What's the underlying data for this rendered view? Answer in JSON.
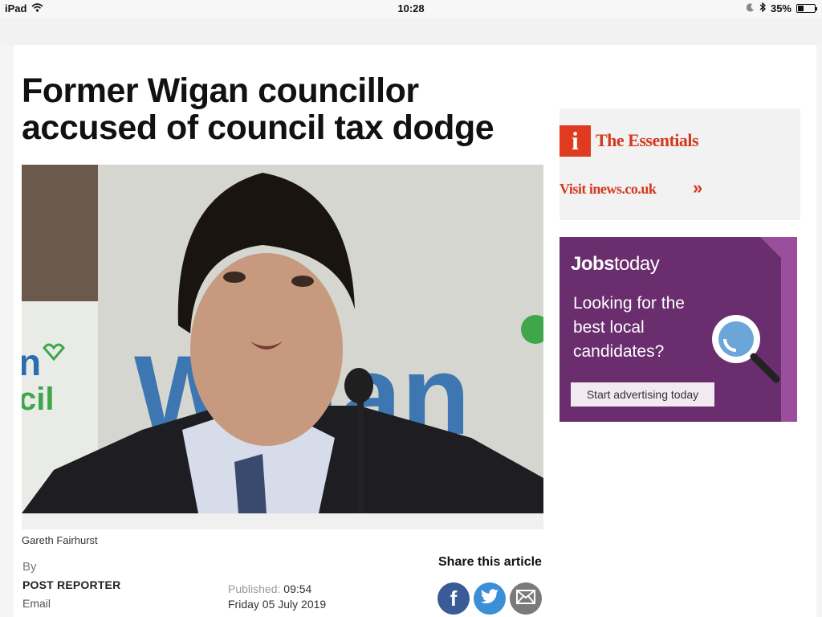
{
  "status_bar": {
    "device": "iPad",
    "time": "10:28",
    "battery": "35%",
    "battery_level": 0.35
  },
  "article": {
    "headline_line1": "Former Wigan councillor",
    "headline_line2": "accused of council tax dodge",
    "caption": "Gareth Fairhurst",
    "by_label": "By",
    "author": "POST REPORTER",
    "email_label": "Email",
    "published_label": "Published:",
    "published_time": "09:54",
    "published_date": "Friday 05 July 2019"
  },
  "share": {
    "title": "Share this article",
    "icons": [
      "facebook-icon",
      "twitter-icon",
      "email-icon"
    ],
    "facebook_glyph": "f"
  },
  "sidebar": {
    "essentials": {
      "logo_letter": "i",
      "title": "The Essentials",
      "link": "Visit inews.co.uk",
      "arrow": "»"
    },
    "jobs_ad": {
      "brand_bold": "Jobs",
      "brand_rest": "today",
      "pitch": "Looking for the best local candidates?",
      "cta": "Start advertising today"
    }
  },
  "colors": {
    "accent_red": "#d3391f",
    "ad_purple": "#6a2d6d",
    "facebook": "#3a5a98",
    "twitter": "#3b8fd6"
  }
}
